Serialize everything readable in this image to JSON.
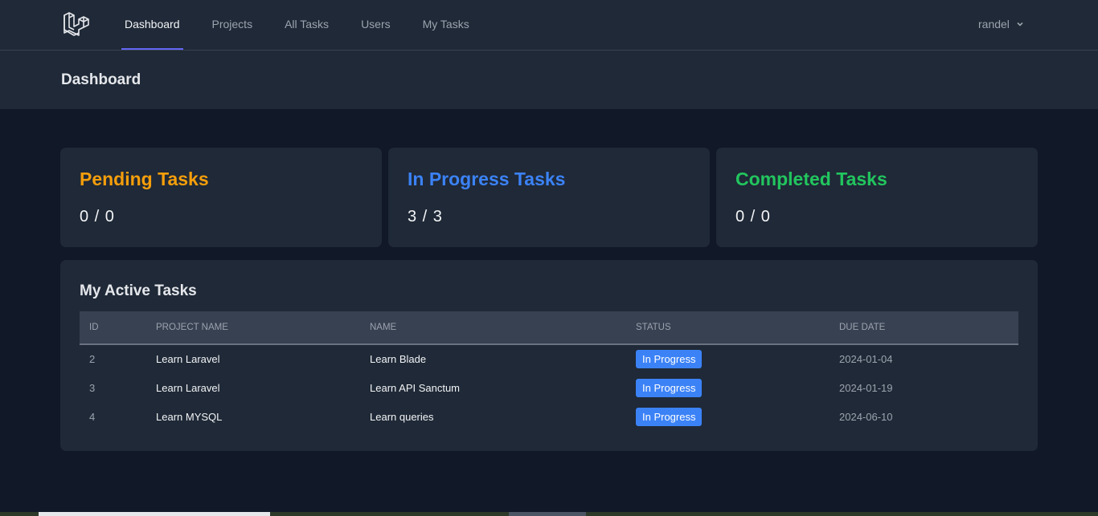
{
  "nav": {
    "logo_icon": "laravel-logo-icon",
    "links": [
      {
        "label": "Dashboard",
        "active": true
      },
      {
        "label": "Projects",
        "active": false
      },
      {
        "label": "All Tasks",
        "active": false
      },
      {
        "label": "Users",
        "active": false
      },
      {
        "label": "My Tasks",
        "active": false
      }
    ],
    "user": {
      "name": "randel",
      "icon": "chevron-down-icon"
    }
  },
  "header": {
    "title": "Dashboard"
  },
  "stats": [
    {
      "title": "Pending Tasks",
      "value": "0 / 0",
      "color": "#f59e0b"
    },
    {
      "title": "In Progress Tasks",
      "value": "3 / 3",
      "color": "#3b82f6"
    },
    {
      "title": "Completed Tasks",
      "value": "0 / 0",
      "color": "#22c55e"
    }
  ],
  "tasks": {
    "title": "My Active Tasks",
    "columns": [
      "ID",
      "PROJECT NAME",
      "NAME",
      "STATUS",
      "DUE DATE"
    ],
    "rows": [
      {
        "id": "2",
        "project": "Learn Laravel",
        "name": "Learn Blade",
        "status": "In Progress",
        "due": "2024-01-04"
      },
      {
        "id": "3",
        "project": "Learn Laravel",
        "name": "Learn API Sanctum",
        "status": "In Progress",
        "due": "2024-01-19"
      },
      {
        "id": "4",
        "project": "Learn MYSQL",
        "name": "Learn queries",
        "status": "In Progress",
        "due": "2024-06-10"
      }
    ]
  }
}
